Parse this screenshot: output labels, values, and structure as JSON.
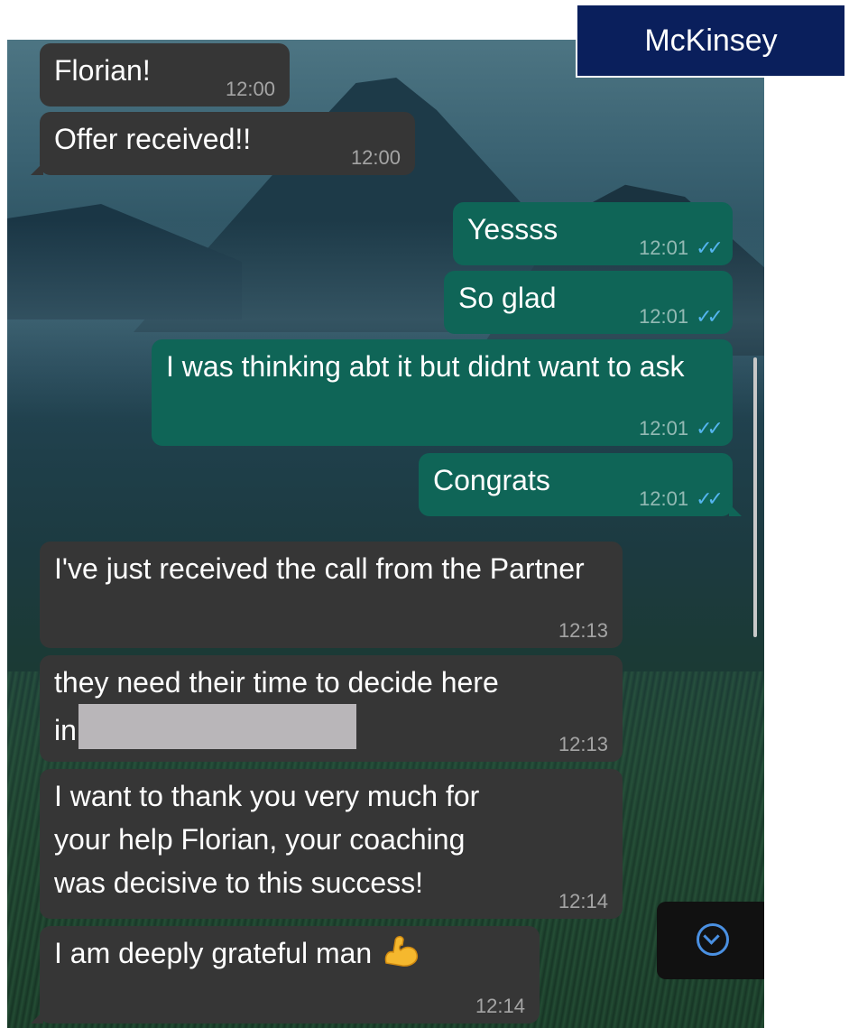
{
  "brand": {
    "label": "McKinsey",
    "background": "#0a1f5c"
  },
  "colors": {
    "incoming_bubble": "#363636",
    "outgoing_bubble": "#0f6557",
    "read_ticks": "#54b5ef"
  },
  "messages": [
    {
      "direction": "incoming",
      "text": "Florian!",
      "time": "12:00"
    },
    {
      "direction": "incoming",
      "text": "Offer received!!",
      "time": "12:00"
    },
    {
      "direction": "outgoing",
      "text": "Yessss",
      "time": "12:01",
      "status": "read-ticks-icon"
    },
    {
      "direction": "outgoing",
      "text": "So glad",
      "time": "12:01",
      "status": "read-ticks-icon"
    },
    {
      "direction": "outgoing",
      "text": "I was thinking abt it but didnt want to ask",
      "time": "12:01",
      "status": "read-ticks-icon"
    },
    {
      "direction": "outgoing",
      "text": "Congrats",
      "time": "12:01",
      "status": "read-ticks-icon"
    },
    {
      "direction": "incoming",
      "text": "I've just received the call from the Partner",
      "time": "12:13"
    },
    {
      "direction": "incoming",
      "text_line1": "they need their time to decide here",
      "text_line2": "in",
      "redacted": true,
      "time": "12:13"
    },
    {
      "direction": "incoming",
      "text": "I want to thank you very much for your help Florian, your coaching was decisive to this success!",
      "time": "12:14"
    },
    {
      "direction": "incoming",
      "text": "I am deeply grateful man",
      "emoji": "flexed-biceps-icon",
      "time": "12:14"
    }
  ],
  "scroll_to_bottom": {
    "icon": "chevron-down-icon"
  }
}
